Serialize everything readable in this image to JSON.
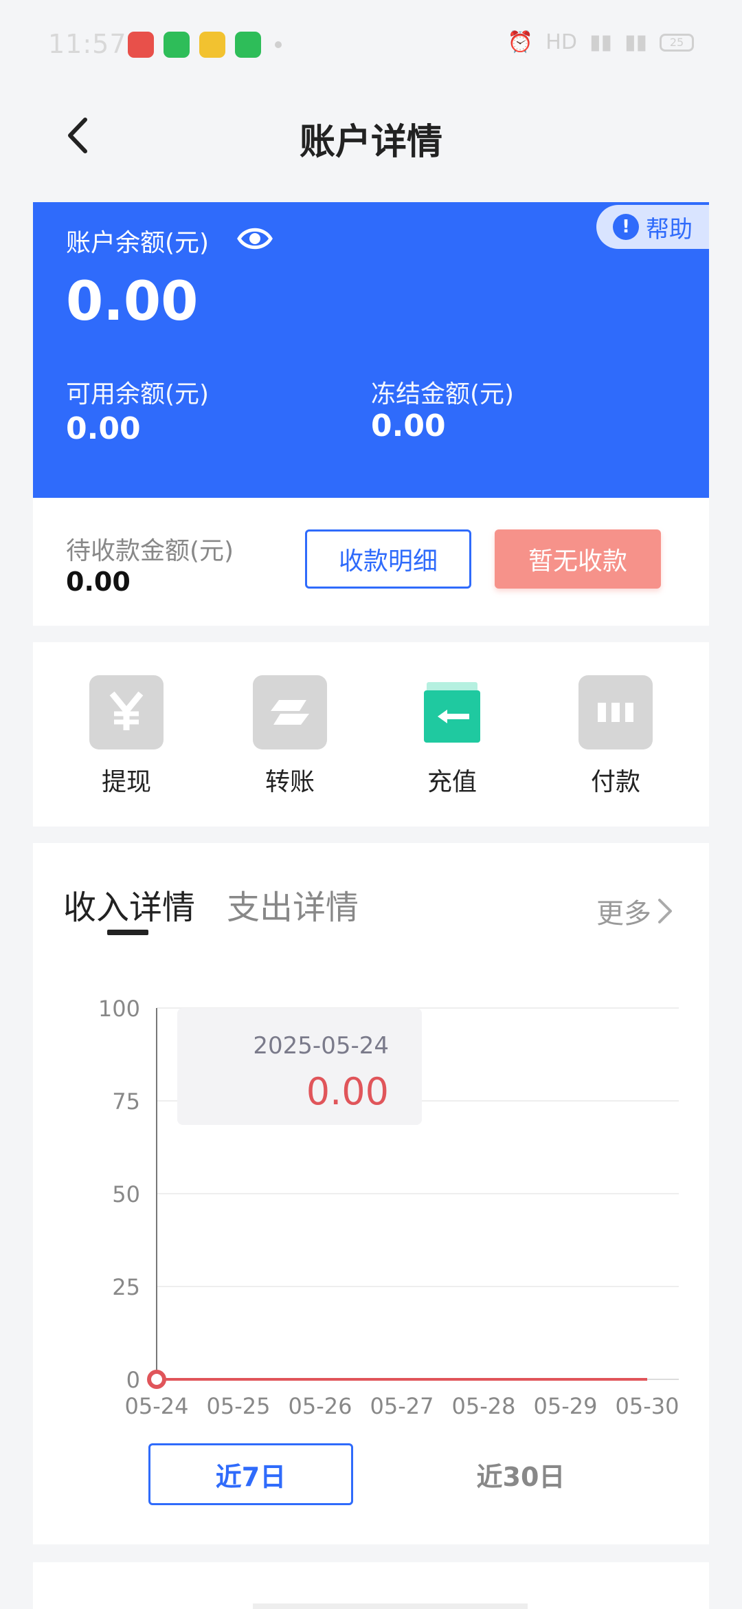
{
  "status_bar": {
    "time": "11:57",
    "network": "HD",
    "battery": "25"
  },
  "header": {
    "title": "账户详情"
  },
  "balance": {
    "label": "账户余额(元)",
    "value": "0.00",
    "help_label": "帮助",
    "available_label": "可用余额(元)",
    "available_value": "0.00",
    "frozen_label": "冻结金额(元)",
    "frozen_value": "0.00"
  },
  "pending": {
    "label": "待收款金额(元)",
    "value": "0.00",
    "detail_button": "收款明细",
    "no_payment_button": "暂无收款"
  },
  "actions": [
    {
      "label": "提现",
      "icon": "yuan-icon"
    },
    {
      "label": "转账",
      "icon": "transfer-icon"
    },
    {
      "label": "充值",
      "icon": "recharge-icon"
    },
    {
      "label": "付款",
      "icon": "payment-icon"
    }
  ],
  "income": {
    "tab_income": "收入详情",
    "tab_expense": "支出详情",
    "more_label": "更多",
    "range_7": "近7日",
    "range_30": "近30日"
  },
  "chart_data": {
    "type": "line",
    "categories": [
      "05-24",
      "05-25",
      "05-26",
      "05-27",
      "05-28",
      "05-29",
      "05-30"
    ],
    "series": [
      {
        "values": [
          0,
          0,
          0,
          0,
          0,
          0,
          0
        ],
        "color": "#e0555a"
      }
    ],
    "yticks": [
      0,
      25,
      50,
      75,
      100
    ],
    "ylim": [
      0,
      100
    ],
    "grid": true,
    "tooltip": {
      "date": "2025-05-24",
      "value": "0.00"
    }
  },
  "colors": {
    "primary": "#2f6bfb",
    "accent_red": "#f6928a",
    "line_red": "#e0555a",
    "recharge_green": "#1fc9a0"
  }
}
